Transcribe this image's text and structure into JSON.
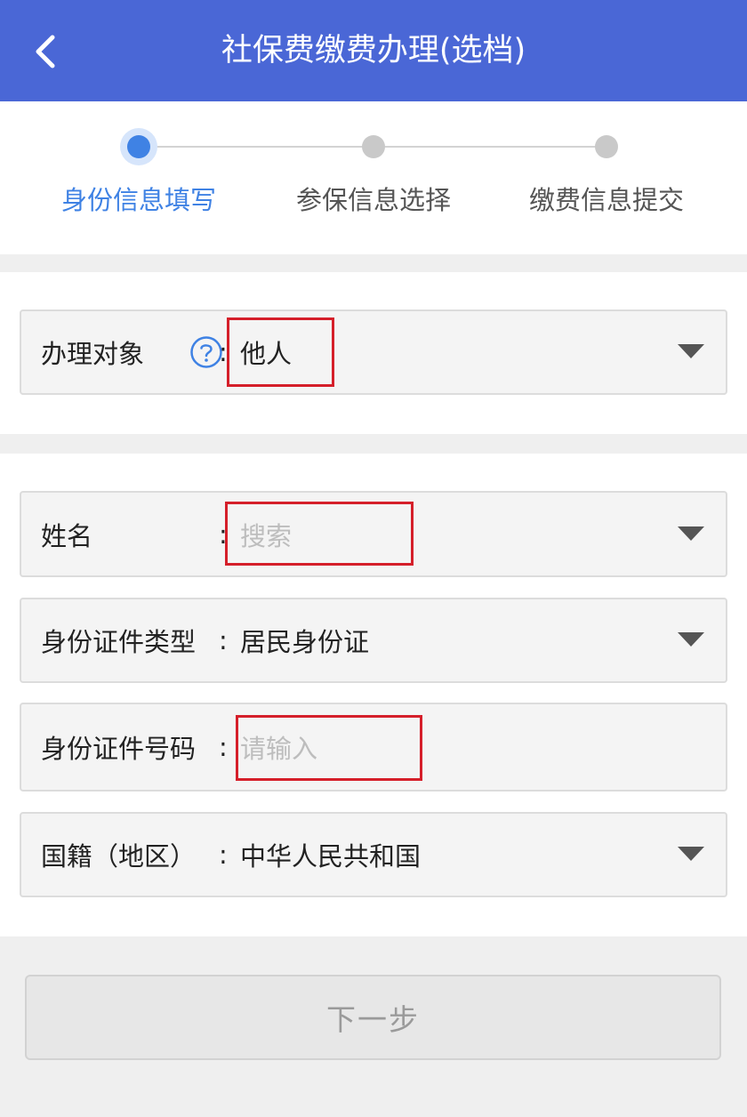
{
  "header": {
    "title": "社保费缴费办理(选档)",
    "back_icon": "chevron-left-icon"
  },
  "steps": [
    {
      "label": "身份信息填写",
      "state": "active"
    },
    {
      "label": "参保信息选择",
      "state": "inactive"
    },
    {
      "label": "缴费信息提交",
      "state": "inactive"
    }
  ],
  "colors": {
    "header_bg": "#4a67d6",
    "active_step": "#3f82e4",
    "highlight_border": "#d51f2a"
  },
  "subject_field": {
    "label": "办理对象",
    "colon": ":",
    "value": "他人",
    "help_icon": "question-circle-icon"
  },
  "name_field": {
    "label": "姓名",
    "colon": ":",
    "placeholder": "搜索"
  },
  "id_type_field": {
    "label": "身份证件类型",
    "colon": ":",
    "value": "居民身份证"
  },
  "id_number_field": {
    "label": "身份证件号码",
    "colon": ":",
    "placeholder": "请输入"
  },
  "nationality_field": {
    "label": "国籍（地区）",
    "colon": ":",
    "value": "中华人民共和国"
  },
  "next_button": {
    "label": "下一步",
    "enabled": false
  }
}
